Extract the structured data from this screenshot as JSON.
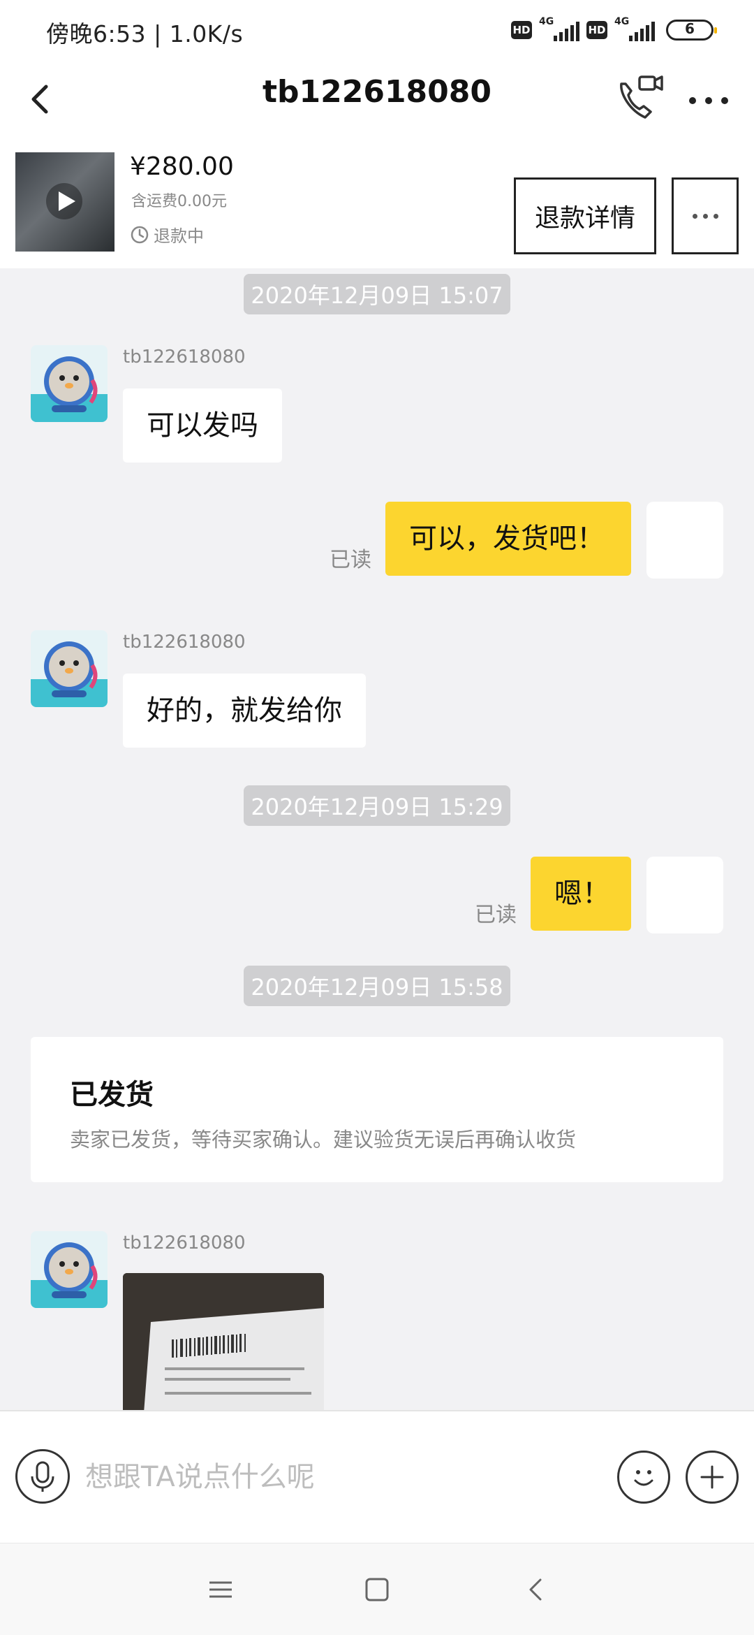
{
  "status_bar": {
    "left_text": "傍晚6:53 | 1.0K/s",
    "hd_label": "HD",
    "network_label": "4G",
    "battery_level": "6"
  },
  "header": {
    "title": "tb122618080",
    "icons": [
      "back-icon",
      "phone-video-icon",
      "more-icon"
    ]
  },
  "product": {
    "price": "¥280.00",
    "shipping": "含运费0.00元",
    "status": "退款中",
    "refund_button": "退款详情"
  },
  "chat": {
    "messages": [
      {
        "kind": "timestamp",
        "text": "2020年12月09日 15:07"
      },
      {
        "kind": "incoming",
        "sender": "tb122618080",
        "text": "可以发吗"
      },
      {
        "kind": "outgoing",
        "text": "可以，发货吧！",
        "read": "已读"
      },
      {
        "kind": "incoming",
        "sender": "tb122618080",
        "text": "好的，就发给你"
      },
      {
        "kind": "timestamp",
        "text": "2020年12月09日 15:29"
      },
      {
        "kind": "outgoing",
        "text": "嗯！",
        "read": "已读"
      },
      {
        "kind": "timestamp",
        "text": "2020年12月09日 15:58"
      },
      {
        "kind": "shipment_card",
        "title": "已发货",
        "text": "卖家已发货，等待买家确认。建议验货无误后再确认收货"
      },
      {
        "kind": "incoming_image",
        "sender": "tb122618080"
      }
    ]
  },
  "input_bar": {
    "placeholder": "想跟TA说点什么呢"
  },
  "nav_bar": {
    "icons": [
      "menu-icon",
      "home-square-icon",
      "back-chevron-icon"
    ]
  },
  "colors": {
    "outgoing_bubble": "#fcd52f",
    "chat_background": "#f2f2f4",
    "timestamp_bg": "#cfcfd1"
  }
}
